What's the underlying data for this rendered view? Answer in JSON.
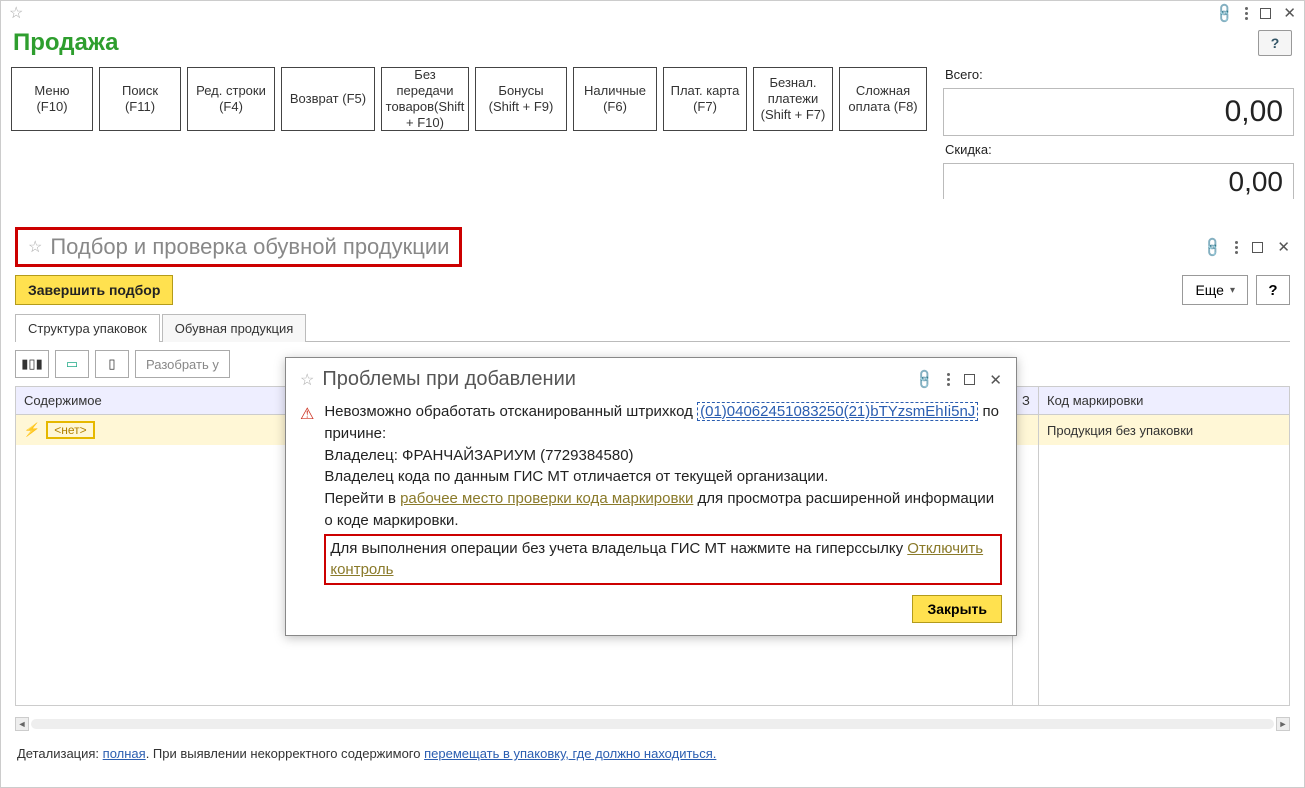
{
  "main": {
    "title": "Продажа",
    "buttons": [
      "Меню (F10)",
      "Поиск (F11)",
      "Ред. строки (F4)",
      "Возврат (F5)",
      "Без передачи товаров(Shift + F10)",
      "Бонусы (Shift + F9)",
      "Наличные (F6)",
      "Плат. карта (F7)",
      "Безнал. платежи (Shift + F7)",
      "Сложная оплата (F8)"
    ],
    "total_label": "Всего:",
    "total_value": "0,00",
    "discount_label": "Скидка:",
    "discount_value": "0,00"
  },
  "sub": {
    "title": "Подбор и проверка обувной продукции",
    "finish_btn": "Завершить подбор",
    "more_btn": "Еще",
    "tabs": [
      "Структура упаковок",
      "Обувная продукция"
    ],
    "tb_text_btn": "Разобрать у",
    "col_content": "Содержимое",
    "col_mark": "Код маркировки",
    "row_tag": "<нет>",
    "right_row": "Продукция без упаковки",
    "footer_prefix": "Детализация: ",
    "footer_link1": "полная",
    "footer_mid": ". При выявлении некорректного содержимого ",
    "footer_link2": "перемещать в упаковку, где должно находиться."
  },
  "popup": {
    "title": "Проблемы при добавлении",
    "l1": "Невозможно обработать отсканированный штрихкод",
    "barcode": "(01)04062451083250(21)bTYzsmEhIi5nJ",
    "l1b": " по причине:",
    "l2": "Владелец: ФРАНЧАЙЗАРИУМ (7729384580)",
    "l3": "Владелец кода по данным ГИС МТ отличается от текущей организации.",
    "l4a": "Перейти в ",
    "l4_link": "рабочее место проверки кода маркировки",
    "l4b": " для просмотра расширенной информации о коде маркировки.",
    "l5a": "Для выполнения операции без учета владельца ГИС МТ нажмите на гиперссылку ",
    "l5_link": "Отключить контроль",
    "close": "Закрыть"
  },
  "widths": [
    "82",
    "82",
    "88",
    "94",
    "88",
    "92",
    "84",
    "84",
    "80",
    "88"
  ]
}
